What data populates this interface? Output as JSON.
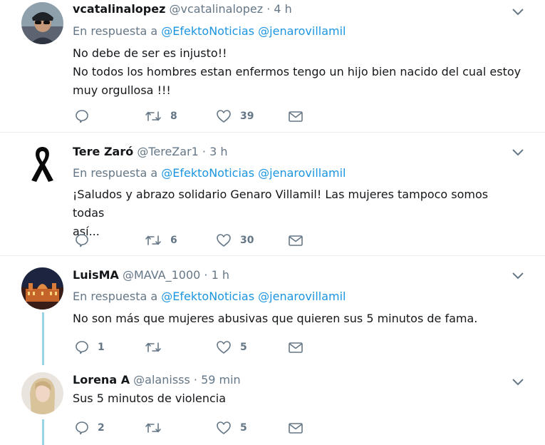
{
  "labels": {
    "reply_prefix": "En respuesta a"
  },
  "colors": {
    "link": "#1b95e0",
    "muted": "#657786",
    "thread_line": "#9ad3e3",
    "divider": "#e6ecf0"
  },
  "icons": {
    "reply": "reply-icon",
    "retweet": "retweet-icon",
    "like": "heart-icon",
    "dm": "envelope-icon",
    "menu": "chevron-down-icon"
  },
  "tweets": [
    {
      "name": "vcatalinalopez",
      "handle": "@vcatalinalopez · 4 h",
      "mentions": [
        "@EfektoNoticias",
        "@jenarovillamil"
      ],
      "lines": [
        "No debe de ser es injusto!!",
        "No todos los hombres estan enfermos tengo un hijo bien nacido del cual estoy",
        "muy orgullosa !!!"
      ],
      "replies": "",
      "retweets": "8",
      "likes": "39"
    },
    {
      "name": "Tere Zaró",
      "handle": "@TereZar1 · 3 h",
      "mentions": [
        "@EfektoNoticias",
        "@jenarovillamil"
      ],
      "lines": [
        "¡Saludos y abrazo solidario Genaro Villamil! Las mujeres tampoco somos todas",
        "así..."
      ],
      "replies": "",
      "retweets": "6",
      "likes": "30"
    },
    {
      "name": "LuisMA",
      "handle": "@MAVA_1000 · 1 h",
      "mentions": [
        "@EfektoNoticias",
        "@jenarovillamil"
      ],
      "lines": [
        "No son más que mujeres abusivas que quieren sus 5 minutos de fama."
      ],
      "replies": "1",
      "retweets": "",
      "likes": "5"
    },
    {
      "name": "Lorena A",
      "handle": "@alanisss · 59 min",
      "mentions": [],
      "lines": [
        "Sus 5 minutos de violencia"
      ],
      "replies": "2",
      "retweets": "",
      "likes": "5"
    }
  ]
}
